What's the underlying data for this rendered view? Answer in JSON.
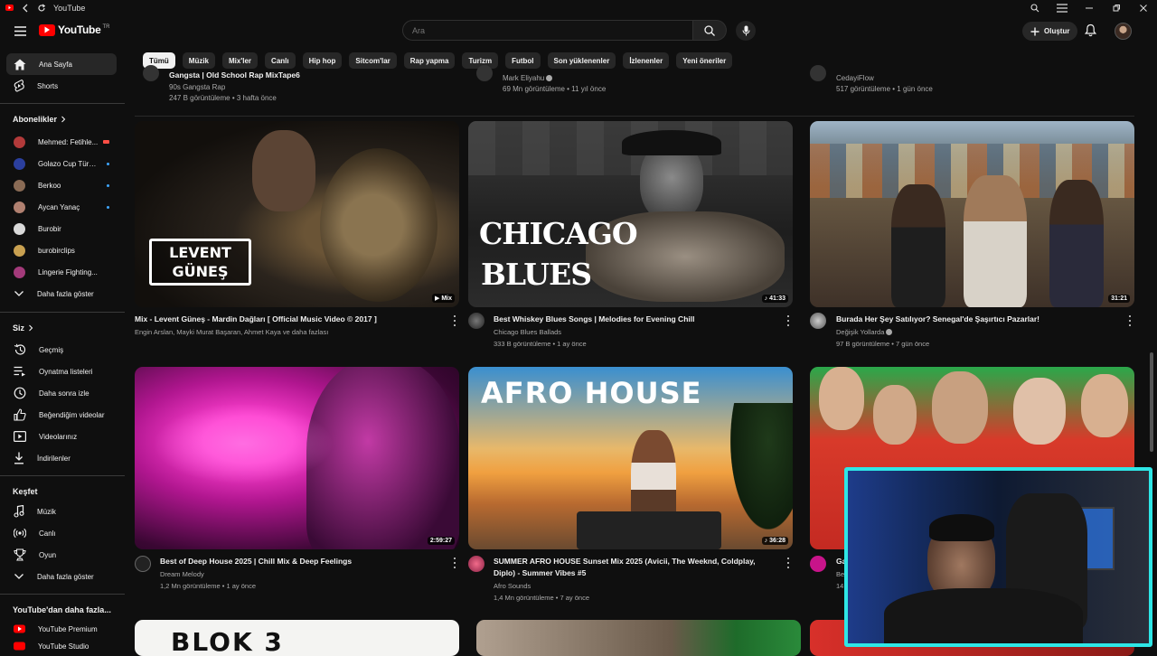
{
  "window": {
    "title": "YouTube"
  },
  "header": {
    "logo_text": "YouTube",
    "logo_country": "TR",
    "search_placeholder": "Ara",
    "create_label": "Oluştur"
  },
  "sidebar": {
    "home": "Ana Sayfa",
    "shorts": "Shorts",
    "subscriptions_heading": "Abonelikler",
    "subscriptions": [
      {
        "name": "Mehmed: Fetihle...",
        "color": "#b23a3a"
      },
      {
        "name": "Golazo Cup Türki...",
        "color": "#2b3f9e"
      },
      {
        "name": "Berkoo",
        "color": "#8a6b55"
      },
      {
        "name": "Aycan Yanaç",
        "color": "#b08070"
      },
      {
        "name": "Burobir",
        "color": "#d9d9d9"
      },
      {
        "name": "burobirclips",
        "color": "#c8a050"
      },
      {
        "name": "Lingerie Fighting...",
        "color": "#a33a7a"
      }
    ],
    "show_more": "Daha fazla göster",
    "you_heading": "Siz",
    "you_items": [
      "Geçmiş",
      "Oynatma listeleri",
      "Daha sonra izle",
      "Beğendiğim videolar",
      "Videolarınız",
      "İndirilenler"
    ],
    "explore_heading": "Keşfet",
    "explore_items": [
      "Müzik",
      "Canlı",
      "Oyun"
    ],
    "explore_more": "Daha fazla göster",
    "more_heading": "YouTube'dan daha fazla...",
    "premium": "YouTube Premium",
    "studio": "YouTube Studio"
  },
  "chips": [
    "Tümü",
    "Müzik",
    "Mix'ler",
    "Canlı",
    "Hip hop",
    "Sitcom'lar",
    "Rap yapma",
    "Turizm",
    "Futbol",
    "Son yüklenenler",
    "İzlenenler",
    "Yeni öneriler"
  ],
  "partial_row": [
    {
      "title": "Gangsta | Old School Rap MixTape6",
      "channel": "90s Gangsta Rap",
      "meta": "247 B görüntüleme • 3 hafta önce"
    },
    {
      "title": "",
      "channel": "Mark Eliyahu",
      "meta": "69 Mn görüntüleme • 11 yıl önce"
    },
    {
      "title": "",
      "channel": "CedayiFlow",
      "meta": "517 görüntüleme • 1 gün önce"
    }
  ],
  "row1": [
    {
      "title": "Mix - Levent Güneş - Mardin Dağları [ Official Music Video © 2017 ]",
      "meta1": "Engin Arslan, Mayki Murat Başaran, Ahmet Kaya ve daha fazlası",
      "meta2": "",
      "badge": "Mix",
      "thumb_text": "LEVENT\nGÜNEŞ"
    },
    {
      "title": "Best Whiskey Blues Songs | Melodies for Evening Chill",
      "meta1": "Chicago Blues Ballads",
      "meta2": "333 B görüntüleme • 1 ay önce",
      "badge": "41:33",
      "thumb_text1": "CHICAGO",
      "thumb_text2": "BLUES"
    },
    {
      "title": "Burada Her Şey Satılıyor? Senegal'de Şaşırtıcı Pazarlar!",
      "meta1": "Değişik Yollarda",
      "meta2": "97 B görüntüleme • 7 gün önce",
      "badge": "31:21"
    }
  ],
  "row2": [
    {
      "title": "Best of Deep House 2025 | Chill Mix & Deep Feelings",
      "meta1": "Dream Melody",
      "meta2": "1,2 Mn görüntüleme • 1 ay önce",
      "badge": "2:59:27"
    },
    {
      "title": "SUMMER AFRO HOUSE Sunset Mix 2025 (Avicii, The Weeknd, Coldplay, Diplo) - Summer Vibes #5",
      "meta1": "Afro Sounds",
      "meta2": "1,4 Mn görüntüleme • 7 ay önce",
      "badge": "36:28",
      "thumb_text": "AFRO HOUSE"
    },
    {
      "title": "Ga",
      "meta1": "Be",
      "meta2": "14"
    }
  ],
  "row3_thumb_text": "BLOK 3"
}
